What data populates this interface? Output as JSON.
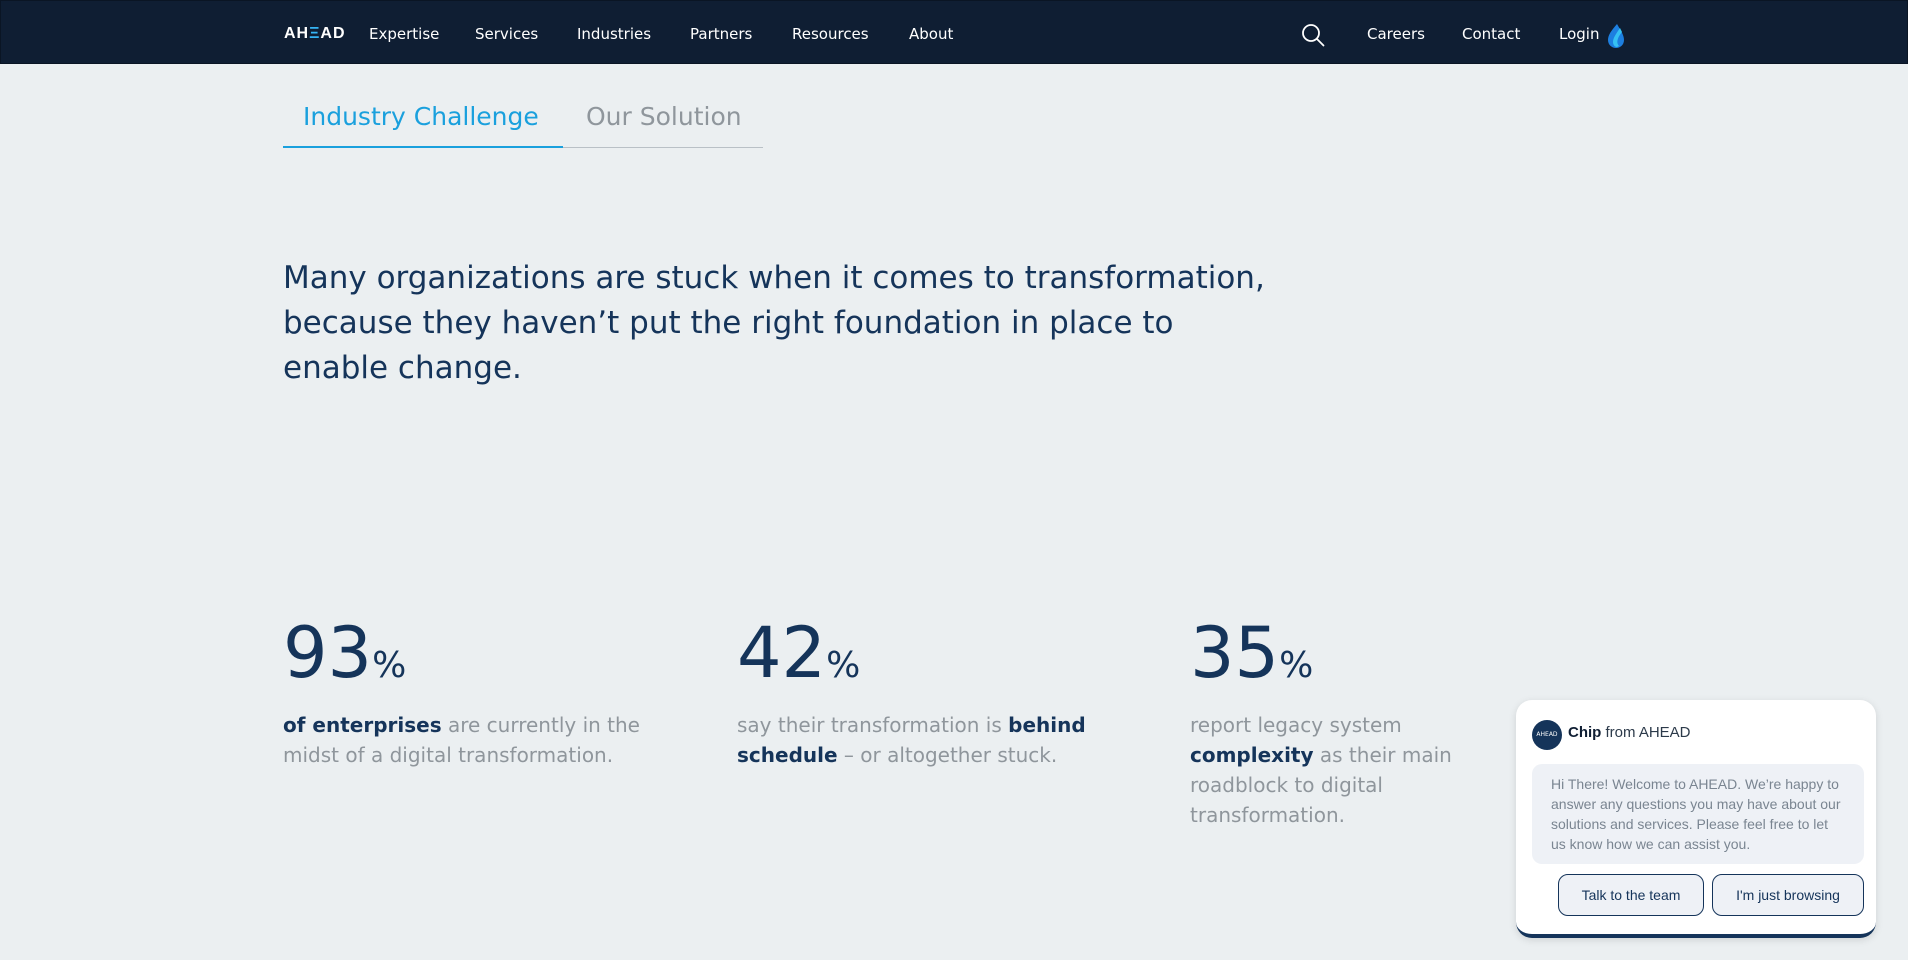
{
  "header": {
    "logo": "AHEAD",
    "nav": [
      "Expertise",
      "Services",
      "Industries",
      "Partners",
      "Resources",
      "About"
    ],
    "right_links": [
      "Careers",
      "Contact",
      "Login"
    ],
    "icons": [
      "search-icon",
      "login-drop-icon"
    ]
  },
  "tabs": [
    "Industry Challenge",
    "Our Solution"
  ],
  "active_tab": "Industry Challenge",
  "headline": "Many organizations are stuck when it comes to transformation, because they haven’t put the right foundation in place to enable change.",
  "stats": [
    {
      "number": "93",
      "unit": "%",
      "bold": "of enterprises",
      "text_after": " are currently in the midst of a digital transformation.",
      "text_before": ""
    },
    {
      "number": "42",
      "unit": "%",
      "text_before": "say their transformation is ",
      "bold": "behind schedule",
      "text_after": " – or altogether stuck."
    },
    {
      "number": "35",
      "unit": "%",
      "text_before": "report legacy system ",
      "bold": "complexity",
      "text_after": " as their main roadblock to digital transformation."
    }
  ],
  "chat": {
    "avatar_text": "AHEAD",
    "name": "Chip",
    "from": " from AHEAD",
    "message": "Hi There! Welcome to AHEAD. We’re happy to answer any questions you may have about our solutions and services. Please feel free to let us know how we can assist you.",
    "buttons": [
      "Talk to the team",
      "I'm just browsing"
    ]
  },
  "colors": {
    "nav_bg": "#0f1e33",
    "page_bg": "#ebeff1",
    "accent": "#1aa0dd",
    "primary_text": "#15345a",
    "muted_text": "#8f969c"
  }
}
